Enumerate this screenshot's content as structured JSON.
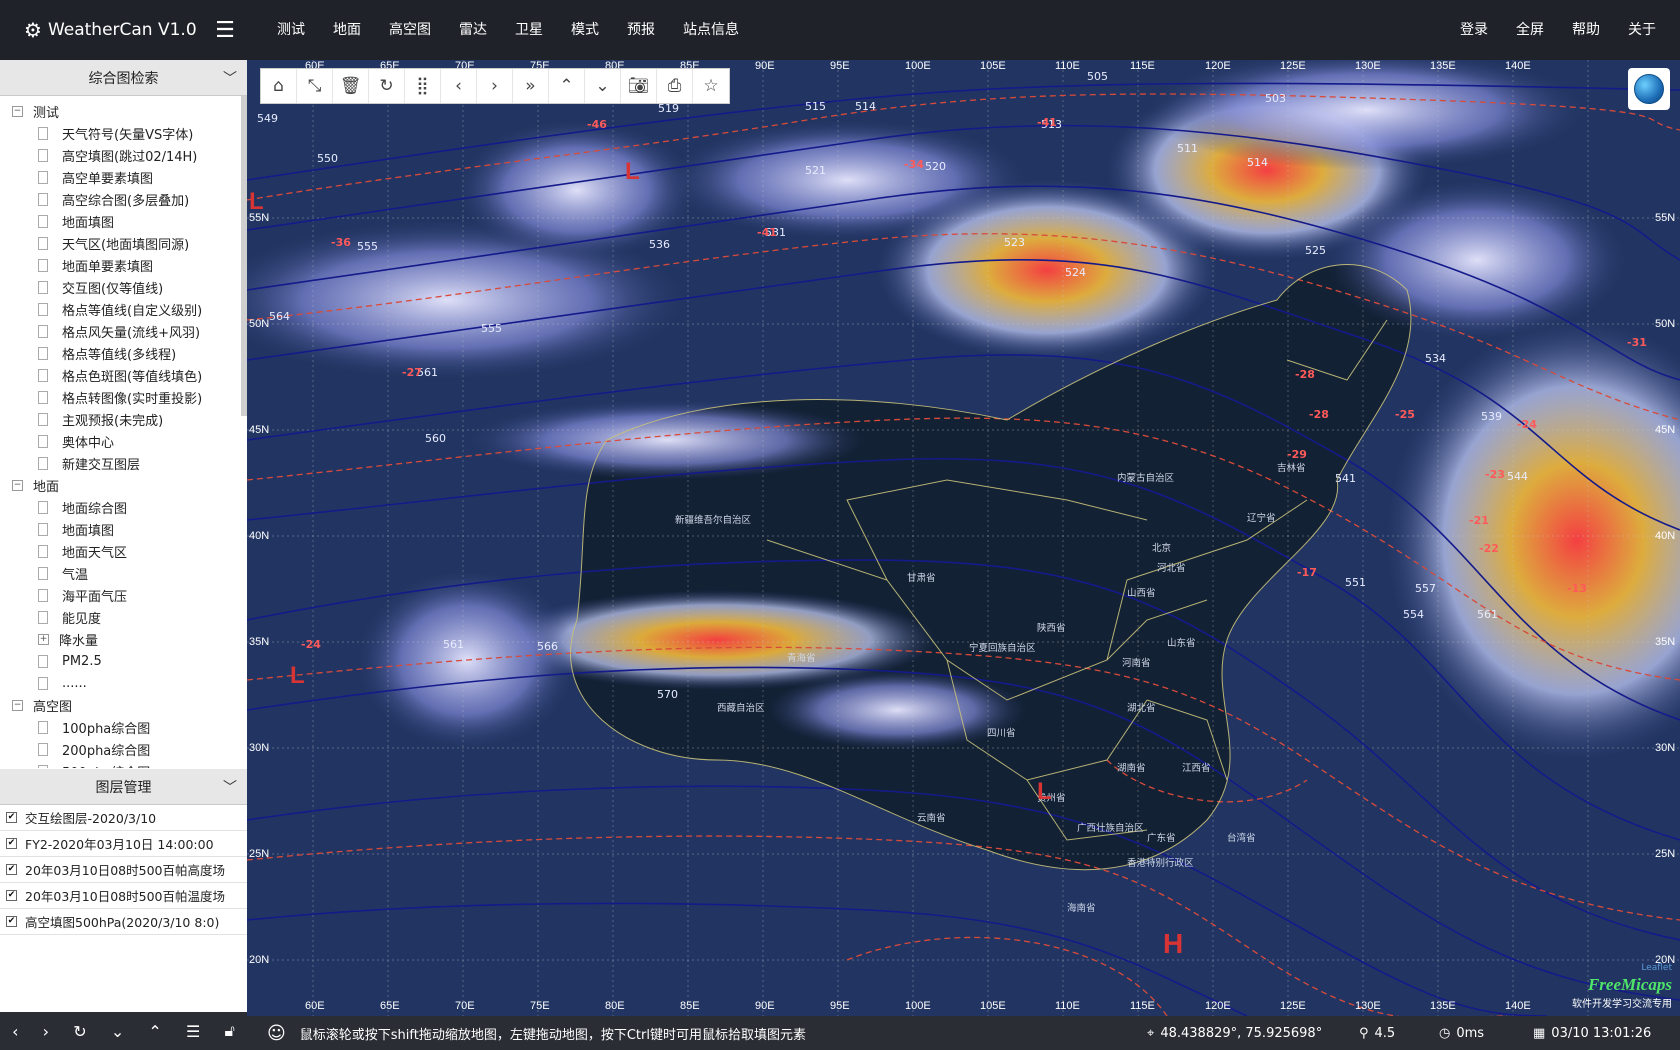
{
  "app": {
    "title": "WeatherCan V1.0"
  },
  "nav": {
    "menu": [
      "测试",
      "地面",
      "高空图",
      "雷达",
      "卫星",
      "模式",
      "预报",
      "站点信息"
    ],
    "right": [
      "登录",
      "全屏",
      "帮助",
      "关于"
    ]
  },
  "sidebar": {
    "search_title": "综合图检索",
    "tree": [
      {
        "label": "测试",
        "type": "group",
        "expander": "−"
      },
      {
        "label": "天气符号(矢量VS字体)",
        "type": "leaf"
      },
      {
        "label": "高空填图(跳过02/14H)",
        "type": "leaf"
      },
      {
        "label": "高空单要素填图",
        "type": "leaf"
      },
      {
        "label": "高空综合图(多层叠加)",
        "type": "leaf"
      },
      {
        "label": "地面填图",
        "type": "leaf"
      },
      {
        "label": "天气区(地面填图同源)",
        "type": "leaf"
      },
      {
        "label": "地面单要素填图",
        "type": "leaf"
      },
      {
        "label": "交互图(仅等值线)",
        "type": "leaf"
      },
      {
        "label": "格点等值线(自定义级别)",
        "type": "leaf"
      },
      {
        "label": "格点风矢量(流线+风羽)",
        "type": "leaf"
      },
      {
        "label": "格点等值线(多线程)",
        "type": "leaf"
      },
      {
        "label": "格点色斑图(等值线填色)",
        "type": "leaf"
      },
      {
        "label": "格点转图像(实时重投影)",
        "type": "leaf"
      },
      {
        "label": "主观预报(未完成)",
        "type": "leaf"
      },
      {
        "label": "奥体中心",
        "type": "leaf"
      },
      {
        "label": "新建交互图层",
        "type": "leaf"
      },
      {
        "label": "地面",
        "type": "group",
        "expander": "−"
      },
      {
        "label": "地面综合图",
        "type": "leaf"
      },
      {
        "label": "地面填图",
        "type": "leaf"
      },
      {
        "label": "地面天气区",
        "type": "leaf"
      },
      {
        "label": "气温",
        "type": "leaf"
      },
      {
        "label": "海平面气压",
        "type": "leaf"
      },
      {
        "label": "能见度",
        "type": "leaf"
      },
      {
        "label": "降水量",
        "type": "subgroup",
        "expander": "+"
      },
      {
        "label": "PM2.5",
        "type": "leaf"
      },
      {
        "label": "......",
        "type": "leaf"
      },
      {
        "label": "高空图",
        "type": "group",
        "expander": "−"
      },
      {
        "label": "100pha综合图",
        "type": "leaf"
      },
      {
        "label": "200pha综合图",
        "type": "leaf"
      },
      {
        "label": "500pha综合图",
        "type": "leaf"
      }
    ],
    "layer_title": "图层管理",
    "layers": [
      {
        "label": "交互绘图层-2020/3/10",
        "checked": true
      },
      {
        "label": "FY2-2020年03月10日 14:00:00",
        "checked": true
      },
      {
        "label": "20年03月10日08时500百帕高度场",
        "checked": true
      },
      {
        "label": "20年03月10日08时500百帕温度场",
        "checked": true
      },
      {
        "label": "高空填图500hPa(2020/3/10 8:0)",
        "checked": true
      }
    ]
  },
  "map": {
    "lon_labels": [
      "60E",
      "65E",
      "70E",
      "75E",
      "80E",
      "85E",
      "90E",
      "95E",
      "100E",
      "105E",
      "110E",
      "115E",
      "120E",
      "125E",
      "130E",
      "135E",
      "140E"
    ],
    "lat_labels": [
      "55N",
      "50N",
      "45N",
      "40N",
      "35N",
      "30N",
      "25N",
      "20N"
    ],
    "regions": [
      "新疆维吾尔自治区",
      "西藏自治区",
      "青海省",
      "甘肃省",
      "内蒙古自治区",
      "宁夏回族自治区",
      "陕西省",
      "山西省",
      "河北省",
      "北京",
      "山东省",
      "河南省",
      "四川省",
      "湖北省",
      "湖南省",
      "云南省",
      "贵州省",
      "广西壮族自治区",
      "广东省",
      "江西省",
      "辽宁省",
      "吉林省",
      "台湾省",
      "香港特别行政区",
      "海南省"
    ],
    "contours": [
      "505",
      "503",
      "515",
      "514",
      "519",
      "513",
      "511",
      "520",
      "514",
      "549",
      "550",
      "521",
      "531",
      "523",
      "555",
      "536",
      "525",
      "564",
      "555",
      "524",
      "561",
      "534",
      "560",
      "539",
      "544",
      "541",
      "554",
      "551",
      "557",
      "561",
      "570",
      "561",
      "566"
    ],
    "temps": [
      "-46",
      "-41",
      "-34",
      "-41",
      "-28",
      "-36",
      "-27",
      "-29",
      "-28",
      "-31",
      "-25",
      "-23",
      "-21",
      "-24",
      "-17",
      "-13",
      "-22",
      "-24"
    ],
    "lows": [
      "L",
      "L",
      "L",
      "L"
    ],
    "high": "H",
    "logo": "FreeMicaps",
    "logo_sub": "软件开发学习交流专用",
    "attribution": "Leaflet"
  },
  "status": {
    "tip": "鼠标滚轮或按下shift拖动缩放地图，左键拖动地图，按下Ctrl键时可用鼠标拾取填图元素",
    "coords": "48.438829°, 75.925698°",
    "zoom": "4.5",
    "speed": "0ms",
    "time": "03/10 13:01:26"
  }
}
